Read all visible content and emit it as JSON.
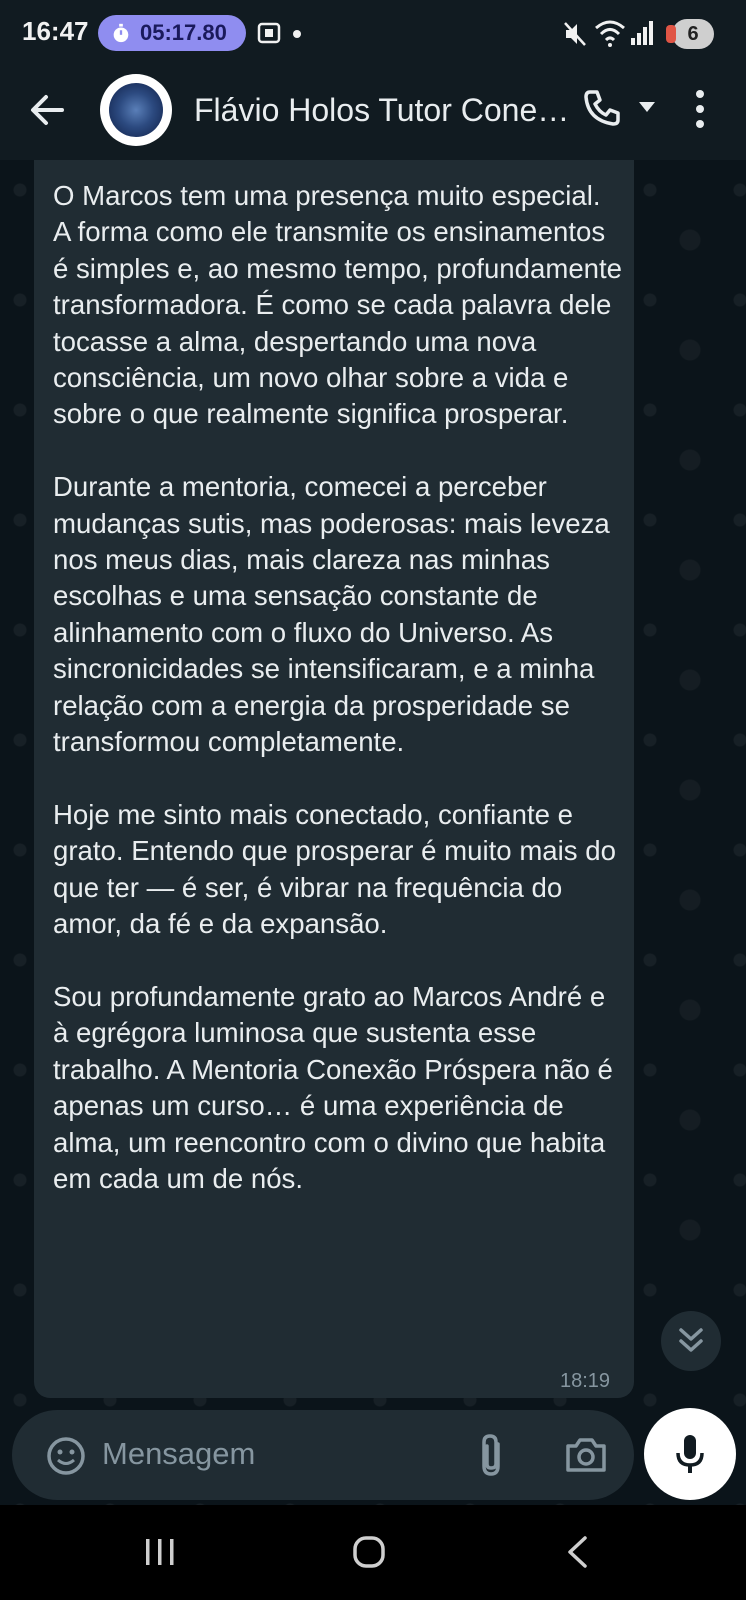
{
  "status_bar": {
    "time": "16:47",
    "timer": "05:17.80",
    "battery_level": "6",
    "icons": [
      "stopwatch-icon",
      "screen-record-icon",
      "notification-dot-icon",
      "mute-icon",
      "wifi-icon",
      "signal-icon",
      "battery-icon"
    ]
  },
  "header": {
    "title": "Flávio Holos Tutor Cone…",
    "icons": [
      "back-arrow-icon",
      "avatar",
      "call-icon",
      "dropdown-icon",
      "more-options-icon"
    ]
  },
  "message": {
    "paragraphs": [
      "O Marcos tem uma presença muito especial. A forma como ele transmite os ensinamentos é simples e, ao mesmo tempo, profundamente transformadora. É como se cada palavra dele tocasse a alma, despertando uma nova consciência, um novo olhar sobre a vida e sobre o que realmente significa prosperar.",
      "Durante a mentoria, comecei a perceber mudanças sutis, mas poderosas: mais leveza nos meus dias, mais clareza nas minhas escolhas e uma sensação constante de alinhamento com o fluxo do Universo. As sincronicidades se intensificaram, e a minha relação com a energia da prosperidade se transformou completamente.",
      "Hoje me sinto mais conectado, confiante e grato. Entendo que prosperar é muito mais do que ter — é ser, é vibrar na frequência do amor, da fé e da expansão.",
      "Sou profundamente grato ao Marcos André e à egrégora luminosa que sustenta esse trabalho. A Mentoria Conexão Próspera não é apenas um curso… é uma experiência de alma, um reencontro com o divino que habita em cada um de nós."
    ],
    "time": "18:19"
  },
  "composer": {
    "placeholder": "Mensagem",
    "icons": [
      "emoji-icon",
      "attach-icon",
      "camera-icon",
      "mic-icon"
    ]
  },
  "scroll_button": {
    "icon": "double-chevron-down-icon"
  },
  "nav_bar": {
    "icons": [
      "recent-apps-icon",
      "home-icon",
      "nav-back-icon"
    ]
  },
  "colors": {
    "background": "#0b141a",
    "header": "#111b21",
    "bubble": "#202c33",
    "text": "#e9edef",
    "muted": "#8696a0",
    "timer_pill": "#8f8df0"
  }
}
